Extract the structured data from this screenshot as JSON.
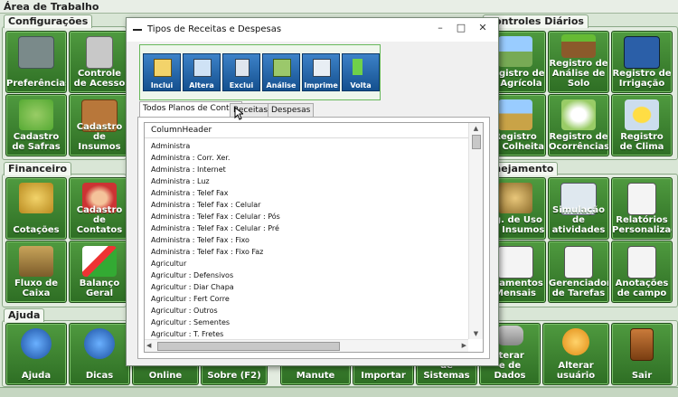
{
  "desktop": {
    "title": "Área de Trabalho",
    "sections": {
      "configuracoes": "Configurações",
      "controles": "Controles Diários",
      "financeiro": "Financeiro",
      "planejamento": "anejamento",
      "ajuda": "Ajuda"
    },
    "tiles": {
      "preferencias": "Preferências",
      "controle_acesso_1": "Controle",
      "controle_acesso_2": "de Acesso",
      "cadastro_safras_1": "Cadastro",
      "cadastro_safras_2": "de Safras",
      "cadastro_insumos_1": "Cadastro de",
      "cadastro_insumos_2": "Insumos",
      "registro_agricola_1": "Registro de",
      "registro_agricola_2": "v. Agrícola",
      "analise_solo_1": "Registro de",
      "analise_solo_2": "Análise de",
      "analise_solo_3": "Solo",
      "irrigacao_1": "Registro de",
      "irrigacao_2": "Irrigação",
      "colheita_1": "Registro",
      "colheita_2": "de Colheita",
      "ocorrencias_1": "Registro de",
      "ocorrencias_2": "Ocorrências",
      "clima_1": "Registro",
      "clima_2": "de Clima",
      "cotacoes": "Cotações",
      "cadastro_contatos_1": "Cadastro",
      "cadastro_contatos_2": "de Contatos",
      "uso_insumos_1": "og. de Uso",
      "uso_insumos_2": "de Insumos",
      "simulacao_1": "Simulação",
      "simulacao_2": "de atividades",
      "relatorios_1": "Relatórios",
      "relatorios_2": "Personalizados",
      "fluxo_caixa_1": "Fluxo de",
      "fluxo_caixa_2": "Caixa",
      "balanco_1": "Balanço",
      "balanco_2": "Geral",
      "lancamentos_1": "nçamentos",
      "lancamentos_2": "Mensais",
      "tarefas_1": "Gerenciador",
      "tarefas_2": "de Tarefas",
      "anotacoes_1": "Anotações",
      "anotacoes_2": "de campo",
      "ajuda": "Ajuda",
      "dicas": "Dicas",
      "online": "Online",
      "sobre": "Sobre (F2)",
      "manute": "Manute",
      "importar": "Importar",
      "sistemas": "de Sistemas",
      "base_1": "lterar",
      "base_2": "e de",
      "base_3": "Dados",
      "alterar_usuario_1": "Alterar",
      "alterar_usuario_2": "usuário",
      "sair": "Sair"
    }
  },
  "dialog": {
    "title": "Tipos de Receitas e Despesas",
    "controls": {
      "minimize": "–",
      "maximize": "□",
      "close": "✕"
    },
    "toolbar": [
      "Inclui",
      "Altera",
      "Exclui",
      "Análise",
      "Imprime",
      "Volta"
    ],
    "tabs": [
      "Todos Planos de Contas",
      "Receitas",
      "Despesas"
    ],
    "selected_tab": "Todos Planos de Contas",
    "list": {
      "column_header": "ColumnHeader",
      "rows": [
        "Administra",
        "Administra : Corr. Xer.",
        "Administra : Internet",
        "Administra : Luz",
        "Administra : Telef Fax",
        "Administra : Telef Fax : Celular",
        "Administra : Telef Fax : Celular : Pós",
        "Administra : Telef Fax : Celular : Pré",
        "Administra : Telef Fax : Fixo",
        "Administra : Telef Fax : Fixo Faz",
        "Agricultur",
        "Agricultur : Defensivos",
        "Agricultur : Diar Chapa",
        "Agricultur : Fert Corre",
        "Agricultur : Outros",
        "Agricultur : Sementes",
        "Agricultur : T. Fretes"
      ]
    }
  }
}
